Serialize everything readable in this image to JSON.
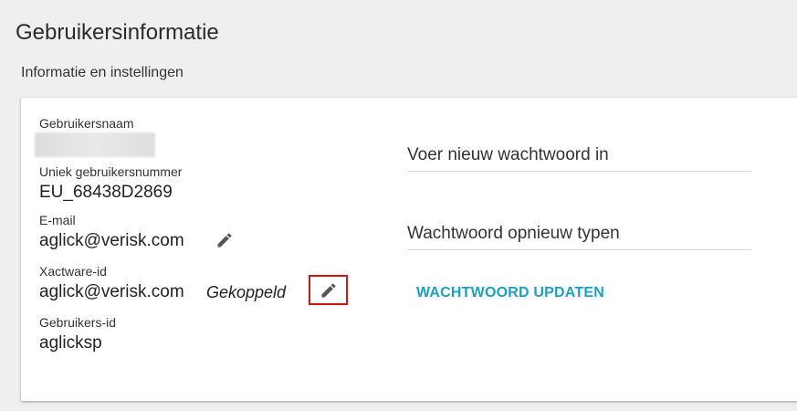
{
  "page": {
    "title": "Gebruikersinformatie",
    "section_label": "Informatie en instellingen"
  },
  "user_info": {
    "username_label": "Gebruikersnaam",
    "unique_id_label": "Uniek gebruikersnummer",
    "unique_id_value": "EU_68438D2869",
    "email_label": "E-mail",
    "email_value": "aglick@verisk.com",
    "xactware_label": "Xactware-id",
    "xactware_value": "aglick@verisk.com",
    "xactware_status": "Gekoppeld",
    "user_id_label": "Gebruikers-id",
    "user_id_value": "aglicksp"
  },
  "password": {
    "new_placeholder": "Voer nieuw wachtwoord in",
    "retype_placeholder": "Wachtwoord opnieuw typen",
    "update_label": "WACHTWOORD UPDATEN"
  },
  "icons": {
    "edit_email": "pencil-icon",
    "edit_xactware": "pencil-icon"
  },
  "colors": {
    "accent": "#1f9ec4",
    "highlight": "#d41414",
    "background": "#efefef"
  }
}
